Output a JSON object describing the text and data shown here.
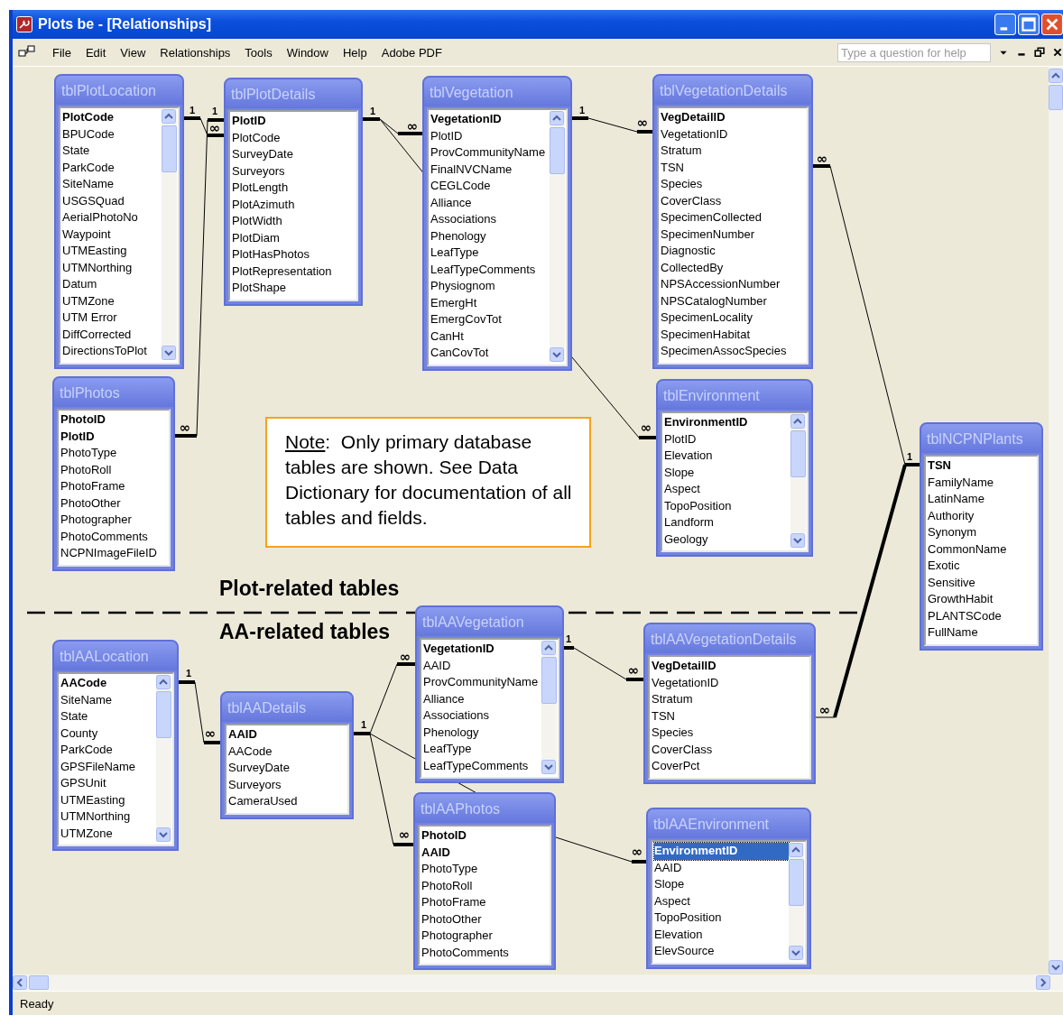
{
  "window": {
    "title": "Plots be - [Relationships]"
  },
  "menu": [
    "File",
    "Edit",
    "View",
    "Relationships",
    "Tools",
    "Window",
    "Help",
    "Adobe PDF"
  ],
  "help_box": {
    "placeholder": "Type a question for help"
  },
  "tables": [
    {
      "title": "tblPlotLocation",
      "scrollbar": true,
      "fields": [
        {
          "name": "PlotCode",
          "key": true,
          "selected": false
        },
        {
          "name": "BPUCode",
          "key": false,
          "selected": false
        },
        {
          "name": "State",
          "key": false,
          "selected": false
        },
        {
          "name": "ParkCode",
          "key": false,
          "selected": false
        },
        {
          "name": "SiteName",
          "key": false,
          "selected": false
        },
        {
          "name": "USGSQuad",
          "key": false,
          "selected": false
        },
        {
          "name": "AerialPhotoNo",
          "key": false,
          "selected": false
        },
        {
          "name": "Waypoint",
          "key": false,
          "selected": false
        },
        {
          "name": "UTMEasting",
          "key": false,
          "selected": false
        },
        {
          "name": "UTMNorthing",
          "key": false,
          "selected": false
        },
        {
          "name": "Datum",
          "key": false,
          "selected": false
        },
        {
          "name": "UTMZone",
          "key": false,
          "selected": false
        },
        {
          "name": "UTM Error",
          "key": false,
          "selected": false
        },
        {
          "name": "DiffCorrected",
          "key": false,
          "selected": false
        },
        {
          "name": "DirectionsToPlot",
          "key": false,
          "selected": false
        }
      ]
    },
    {
      "title": "tblPlotDetails",
      "scrollbar": false,
      "fields": [
        {
          "name": "PlotID",
          "key": true,
          "selected": false
        },
        {
          "name": "PlotCode",
          "key": false,
          "selected": false
        },
        {
          "name": "SurveyDate",
          "key": false,
          "selected": false
        },
        {
          "name": "Surveyors",
          "key": false,
          "selected": false
        },
        {
          "name": "PlotLength",
          "key": false,
          "selected": false
        },
        {
          "name": "PlotAzimuth",
          "key": false,
          "selected": false
        },
        {
          "name": "PlotWidth",
          "key": false,
          "selected": false
        },
        {
          "name": "PlotDiam",
          "key": false,
          "selected": false
        },
        {
          "name": "PlotHasPhotos",
          "key": false,
          "selected": false
        },
        {
          "name": "PlotRepresentation",
          "key": false,
          "selected": false
        },
        {
          "name": "PlotShape",
          "key": false,
          "selected": false
        }
      ]
    },
    {
      "title": "tblVegetation",
      "scrollbar": true,
      "fields": [
        {
          "name": "VegetationID",
          "key": true,
          "selected": false
        },
        {
          "name": "PlotID",
          "key": false,
          "selected": false
        },
        {
          "name": "ProvCommunityName",
          "key": false,
          "selected": false
        },
        {
          "name": "FinalNVCName",
          "key": false,
          "selected": false
        },
        {
          "name": "CEGLCode",
          "key": false,
          "selected": false
        },
        {
          "name": "Alliance",
          "key": false,
          "selected": false
        },
        {
          "name": "Associations",
          "key": false,
          "selected": false
        },
        {
          "name": "Phenology",
          "key": false,
          "selected": false
        },
        {
          "name": "LeafType",
          "key": false,
          "selected": false
        },
        {
          "name": "LeafTypeComments",
          "key": false,
          "selected": false
        },
        {
          "name": "Physiognom",
          "key": false,
          "selected": false
        },
        {
          "name": "EmergHt",
          "key": false,
          "selected": false
        },
        {
          "name": "EmergCovTot",
          "key": false,
          "selected": false
        },
        {
          "name": "CanHt",
          "key": false,
          "selected": false
        },
        {
          "name": "CanCovTot",
          "key": false,
          "selected": false
        }
      ]
    },
    {
      "title": "tblVegetationDetails",
      "scrollbar": false,
      "fields": [
        {
          "name": "VegDetailID",
          "key": true,
          "selected": false
        },
        {
          "name": "VegetationID",
          "key": false,
          "selected": false
        },
        {
          "name": "Stratum",
          "key": false,
          "selected": false
        },
        {
          "name": "TSN",
          "key": false,
          "selected": false
        },
        {
          "name": "Species",
          "key": false,
          "selected": false
        },
        {
          "name": "CoverClass",
          "key": false,
          "selected": false
        },
        {
          "name": "SpecimenCollected",
          "key": false,
          "selected": false
        },
        {
          "name": "SpecimenNumber",
          "key": false,
          "selected": false
        },
        {
          "name": "Diagnostic",
          "key": false,
          "selected": false
        },
        {
          "name": "CollectedBy",
          "key": false,
          "selected": false
        },
        {
          "name": "NPSAccessionNumber",
          "key": false,
          "selected": false
        },
        {
          "name": "NPSCatalogNumber",
          "key": false,
          "selected": false
        },
        {
          "name": "SpecimenLocality",
          "key": false,
          "selected": false
        },
        {
          "name": "SpecimenHabitat",
          "key": false,
          "selected": false
        },
        {
          "name": "SpecimenAssocSpecies",
          "key": false,
          "selected": false
        }
      ]
    },
    {
      "title": "tblPhotos",
      "scrollbar": false,
      "fields": [
        {
          "name": "PhotoID",
          "key": true,
          "selected": false
        },
        {
          "name": "PlotID",
          "key": true,
          "selected": false
        },
        {
          "name": "PhotoType",
          "key": false,
          "selected": false
        },
        {
          "name": "PhotoRoll",
          "key": false,
          "selected": false
        },
        {
          "name": "PhotoFrame",
          "key": false,
          "selected": false
        },
        {
          "name": "PhotoOther",
          "key": false,
          "selected": false
        },
        {
          "name": "Photographer",
          "key": false,
          "selected": false
        },
        {
          "name": "PhotoComments",
          "key": false,
          "selected": false
        },
        {
          "name": "NCPNImageFileID",
          "key": false,
          "selected": false
        }
      ]
    },
    {
      "title": "tblEnvironment",
      "scrollbar": true,
      "fields": [
        {
          "name": "EnvironmentID",
          "key": true,
          "selected": false
        },
        {
          "name": "PlotID",
          "key": false,
          "selected": false
        },
        {
          "name": "Elevation",
          "key": false,
          "selected": false
        },
        {
          "name": "Slope",
          "key": false,
          "selected": false
        },
        {
          "name": "Aspect",
          "key": false,
          "selected": false
        },
        {
          "name": "TopoPosition",
          "key": false,
          "selected": false
        },
        {
          "name": "Landform",
          "key": false,
          "selected": false
        },
        {
          "name": "Geology",
          "key": false,
          "selected": false
        }
      ]
    },
    {
      "title": "tblNCPNPlants",
      "scrollbar": false,
      "fields": [
        {
          "name": "TSN",
          "key": true,
          "selected": false
        },
        {
          "name": "FamilyName",
          "key": false,
          "selected": false
        },
        {
          "name": "LatinName",
          "key": false,
          "selected": false
        },
        {
          "name": "Authority",
          "key": false,
          "selected": false
        },
        {
          "name": "Synonym",
          "key": false,
          "selected": false
        },
        {
          "name": "CommonName",
          "key": false,
          "selected": false
        },
        {
          "name": "Exotic",
          "key": false,
          "selected": false
        },
        {
          "name": "Sensitive",
          "key": false,
          "selected": false
        },
        {
          "name": "GrowthHabit",
          "key": false,
          "selected": false
        },
        {
          "name": "PLANTSCode",
          "key": false,
          "selected": false
        },
        {
          "name": "FullName",
          "key": false,
          "selected": false
        }
      ]
    },
    {
      "title": "tblAALocation",
      "scrollbar": true,
      "fields": [
        {
          "name": "AACode",
          "key": true,
          "selected": false
        },
        {
          "name": "SiteName",
          "key": false,
          "selected": false
        },
        {
          "name": "State",
          "key": false,
          "selected": false
        },
        {
          "name": "County",
          "key": false,
          "selected": false
        },
        {
          "name": "ParkCode",
          "key": false,
          "selected": false
        },
        {
          "name": "GPSFileName",
          "key": false,
          "selected": false
        },
        {
          "name": "GPSUnit",
          "key": false,
          "selected": false
        },
        {
          "name": "UTMEasting",
          "key": false,
          "selected": false
        },
        {
          "name": "UTMNorthing",
          "key": false,
          "selected": false
        },
        {
          "name": "UTMZone",
          "key": false,
          "selected": false
        }
      ]
    },
    {
      "title": "tblAADetails",
      "scrollbar": false,
      "fields": [
        {
          "name": "AAID",
          "key": true,
          "selected": false
        },
        {
          "name": "AACode",
          "key": false,
          "selected": false
        },
        {
          "name": "SurveyDate",
          "key": false,
          "selected": false
        },
        {
          "name": "Surveyors",
          "key": false,
          "selected": false
        },
        {
          "name": "CameraUsed",
          "key": false,
          "selected": false
        }
      ]
    },
    {
      "title": "tblAAVegetation",
      "scrollbar": true,
      "fields": [
        {
          "name": "VegetationID",
          "key": true,
          "selected": false
        },
        {
          "name": "AAID",
          "key": false,
          "selected": false
        },
        {
          "name": "ProvCommunityName",
          "key": false,
          "selected": false
        },
        {
          "name": "Alliance",
          "key": false,
          "selected": false
        },
        {
          "name": "Associations",
          "key": false,
          "selected": false
        },
        {
          "name": "Phenology",
          "key": false,
          "selected": false
        },
        {
          "name": "LeafType",
          "key": false,
          "selected": false
        },
        {
          "name": "LeafTypeComments",
          "key": false,
          "selected": false
        }
      ]
    },
    {
      "title": "tblAAVegetationDetails",
      "scrollbar": false,
      "fields": [
        {
          "name": "VegDetailID",
          "key": true,
          "selected": false
        },
        {
          "name": "VegetationID",
          "key": false,
          "selected": false
        },
        {
          "name": "Stratum",
          "key": false,
          "selected": false
        },
        {
          "name": "TSN",
          "key": false,
          "selected": false
        },
        {
          "name": "Species",
          "key": false,
          "selected": false
        },
        {
          "name": "CoverClass",
          "key": false,
          "selected": false
        },
        {
          "name": "CoverPct",
          "key": false,
          "selected": false
        }
      ]
    },
    {
      "title": "tblAAPhotos",
      "scrollbar": false,
      "fields": [
        {
          "name": "PhotoID",
          "key": true,
          "selected": false
        },
        {
          "name": "AAID",
          "key": true,
          "selected": false
        },
        {
          "name": "PhotoType",
          "key": false,
          "selected": false
        },
        {
          "name": "PhotoRoll",
          "key": false,
          "selected": false
        },
        {
          "name": "PhotoFrame",
          "key": false,
          "selected": false
        },
        {
          "name": "PhotoOther",
          "key": false,
          "selected": false
        },
        {
          "name": "Photographer",
          "key": false,
          "selected": false
        },
        {
          "name": "PhotoComments",
          "key": false,
          "selected": false
        }
      ]
    },
    {
      "title": "tblAAEnvironment",
      "scrollbar": true,
      "fields": [
        {
          "name": "EnvironmentID",
          "key": true,
          "selected": true
        },
        {
          "name": "AAID",
          "key": false,
          "selected": false
        },
        {
          "name": "Slope",
          "key": false,
          "selected": false
        },
        {
          "name": "Aspect",
          "key": false,
          "selected": false
        },
        {
          "name": "TopoPosition",
          "key": false,
          "selected": false
        },
        {
          "name": "Elevation",
          "key": false,
          "selected": false
        },
        {
          "name": "ElevSource",
          "key": false,
          "selected": false
        }
      ]
    }
  ],
  "relationships": [
    {
      "one": "1",
      "many": "∞"
    },
    {
      "one": "1",
      "many": "∞"
    },
    {
      "one": "1",
      "many": "∞"
    },
    {
      "one": "1",
      "many": "∞"
    },
    {
      "many": "∞"
    },
    {
      "one": "1",
      "many": "∞"
    },
    {
      "many": "∞"
    },
    {
      "one": "1",
      "many": "∞"
    },
    {
      "one": "1",
      "many": "∞"
    },
    {
      "many": "∞"
    },
    {
      "one": "1",
      "many": "∞"
    },
    {
      "many": "∞"
    }
  ],
  "note": {
    "label": "Note",
    "text": ":  Only primary database tables are shown. See Data Dictionary for documentation of all tables and fields."
  },
  "sections": [
    "Plot-related tables",
    "AA-related tables"
  ],
  "status_bar": "Ready"
}
